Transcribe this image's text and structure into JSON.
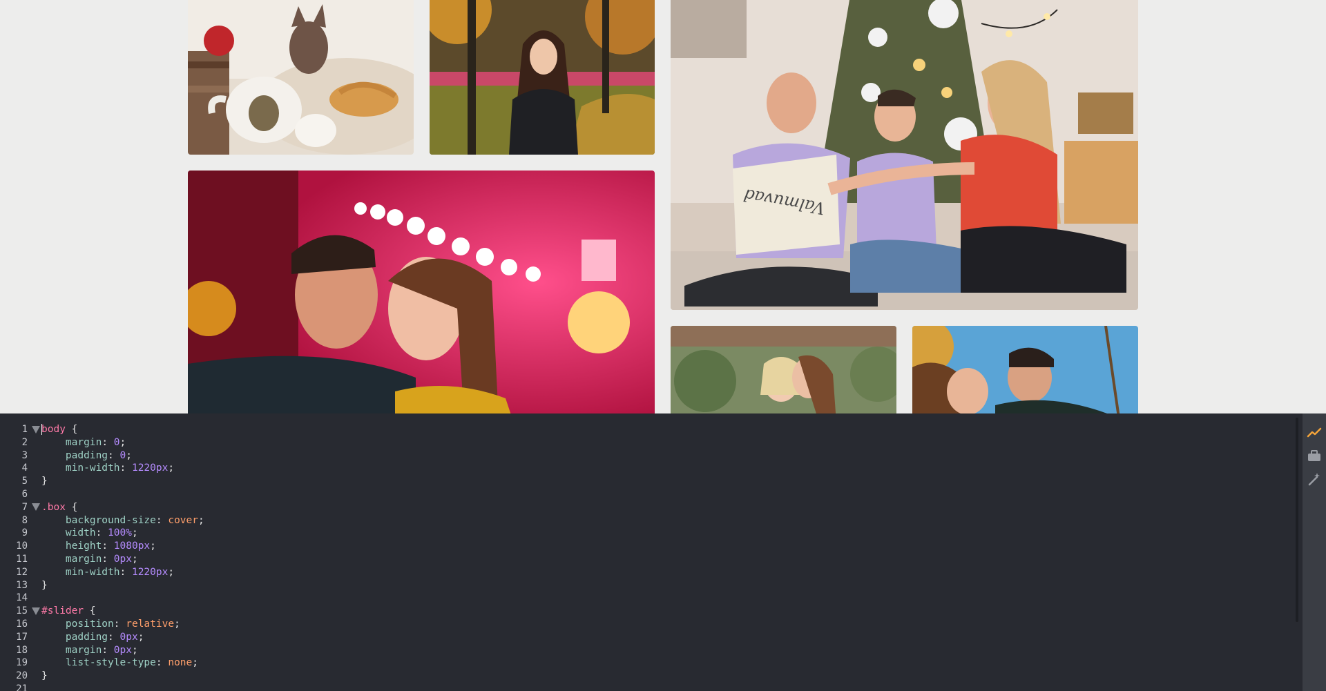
{
  "preview": {
    "photos": [
      {
        "name": "cat-teapot-photo"
      },
      {
        "name": "girl-autumn-park-photo"
      },
      {
        "name": "family-christmas-tree-photo"
      },
      {
        "name": "couple-city-lights-photo"
      },
      {
        "name": "mother-daughter-photo"
      },
      {
        "name": "couple-outdoor-photo"
      }
    ],
    "pillow_text": "Valmuvad"
  },
  "editor": {
    "line_numbers": [
      "1",
      "2",
      "3",
      "4",
      "5",
      "6",
      "7",
      "8",
      "9",
      "10",
      "11",
      "12",
      "13",
      "14",
      "15",
      "16",
      "17",
      "18",
      "19",
      "20",
      "21"
    ],
    "code": {
      "l1_selector": "body",
      "l1_brace": " {",
      "l2_prop": "margin",
      "l2_val": "0",
      "l3_prop": "padding",
      "l3_val": "0",
      "l4_prop": "min-width",
      "l4_val": "1220px",
      "l5": "}",
      "l7_selector": ".box",
      "l7_brace": " {",
      "l8_prop": "background-size",
      "l8_val": "cover",
      "l9_prop": "width",
      "l9_val": "100%",
      "l10_prop": "height",
      "l10_val": "1080px",
      "l11_prop": "margin",
      "l11_val": "0px",
      "l12_prop": "min-width",
      "l12_val": "1220px",
      "l13": "}",
      "l15_selector": "#slider",
      "l15_brace": " {",
      "l16_prop": "position",
      "l16_val": "relative",
      "l17_prop": "padding",
      "l17_val": "0px",
      "l18_prop": "margin",
      "l18_val": "0px",
      "l19_prop": "list-style-type",
      "l19_val": "none",
      "l20": "}"
    },
    "colors": {
      "background": "#282a31",
      "selector": "#ff7aa8",
      "property": "#9fd2c6",
      "number": "#b58cff",
      "keyword": "#ff9f6b"
    }
  },
  "sidebar": {
    "icons": [
      "activity-chart-icon",
      "toolbox-icon",
      "magic-wand-icon"
    ]
  }
}
